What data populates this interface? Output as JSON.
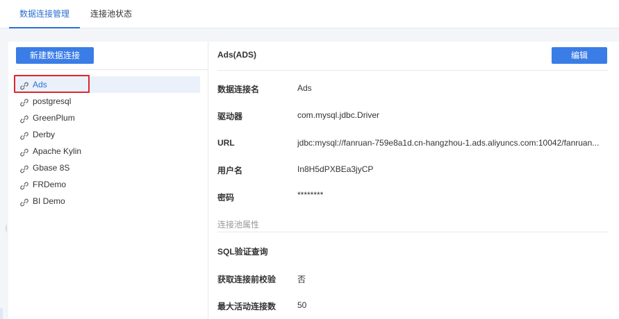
{
  "tabs": [
    {
      "label": "数据连接管理",
      "active": true
    },
    {
      "label": "连接池状态",
      "active": false
    }
  ],
  "left": {
    "new_button": "新建数据连接",
    "connections": [
      "Ads",
      "postgresql",
      "GreenPlum",
      "Derby",
      "Apache Kylin",
      "Gbase 8S",
      "FRDemo",
      "BI Demo"
    ],
    "selected_index": 0,
    "icon": "link-icon"
  },
  "detail": {
    "title": "Ads(ADS)",
    "edit_button": "编辑",
    "fields": [
      {
        "label": "数据连接名",
        "value": "Ads"
      },
      {
        "label": "驱动器",
        "value": "com.mysql.jdbc.Driver"
      },
      {
        "label": "URL",
        "value": "jdbc:mysql://fanruan-759e8a1d.cn-hangzhou-1.ads.aliyuncs.com:10042/fanruan..."
      },
      {
        "label": "用户名",
        "value": "In8H5dPXBEa3jyCP"
      },
      {
        "label": "密码",
        "value": "********"
      }
    ],
    "pool_section_label": "连接池属性",
    "pool_fields": [
      {
        "label": "SQL验证查询",
        "value": ""
      },
      {
        "label": "获取连接前校验",
        "value": "否"
      },
      {
        "label": "最大活动连接数",
        "value": "50"
      }
    ]
  },
  "colors": {
    "accent": "#2b6fd0",
    "button": "#3a7de6",
    "highlight": "#e0242c",
    "selected_bg": "#eaf1fb"
  }
}
